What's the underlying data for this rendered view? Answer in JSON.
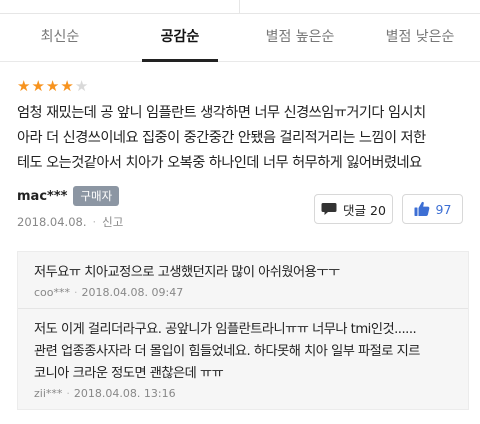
{
  "tabs": [
    {
      "label": "최신순",
      "active": false
    },
    {
      "label": "공감순",
      "active": true
    },
    {
      "label": "별점 높은순",
      "active": false
    },
    {
      "label": "별점 낮은순",
      "active": false
    }
  ],
  "review": {
    "rating": 4,
    "max_rating": 5,
    "lines": [
      "엄청 재밌는데 공 앞니 임플란트 생각하면 너무 신경쓰임ㅠ거기다 임시치",
      "아라 더 신경쓰이네요 집중이 중간중간 안됐음 걸리적거리는 느낌이 저한",
      "테도 오는것같아서 치아가 오복중 하나인데 너무 허무하게 잃어버렸네요"
    ],
    "author": "mac***",
    "badge": "구매자",
    "date": "2018.04.08.",
    "report_label": "신고",
    "comments_button_label": "댓글 20",
    "like_count": "97"
  },
  "comments": [
    {
      "lines": [
        "저두요ㅠ 치아교정으로 고생했던지라 많이 아쉬웠어용ㅜㅜ"
      ],
      "author": "coo***",
      "datetime": "2018.04.08. 09:47"
    },
    {
      "lines": [
        "저도 이게 걸리더라구요. 공앞니가 임플란트라니ㅠㅠ 너무나 tmi인것......",
        "관련 업종종사자라 더 몰입이 힘들었네요. 하다못해 치아 일부 파절로 지르",
        "코니아 크라운 정도면 괜찮은데 ㅠㅠ"
      ],
      "author": "zii***",
      "datetime": "2018.04.08. 13:16"
    }
  ],
  "colors": {
    "star_on": "#f7931e",
    "star_off": "#d9d9d9",
    "badge_bg": "#8c96a3",
    "like_blue": "#3d6fd4"
  },
  "icons": {
    "comment": "speech-bubble-icon",
    "like": "thumbs-up-icon"
  }
}
